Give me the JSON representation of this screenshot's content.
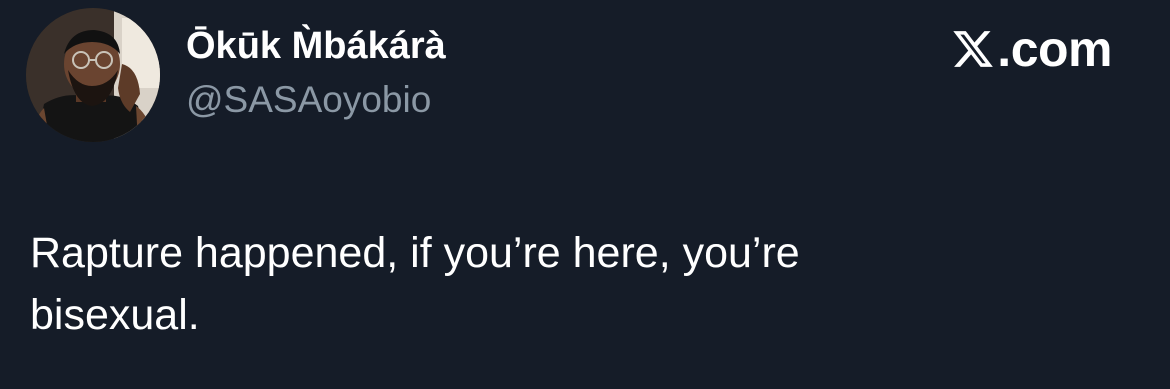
{
  "tweet": {
    "author": {
      "display_name": "Ōkūk M̀bákárà",
      "handle": "@SASAoyobio",
      "avatar_icon": "profile-photo"
    },
    "brand": {
      "logo_icon": "x-logo-icon",
      "text": ".com"
    },
    "text": "Rapture happened, if you’re here, you’re\nbisexual."
  },
  "colors": {
    "background": "#151c28",
    "primary_text": "#ffffff",
    "secondary_text": "#8b98a5"
  }
}
